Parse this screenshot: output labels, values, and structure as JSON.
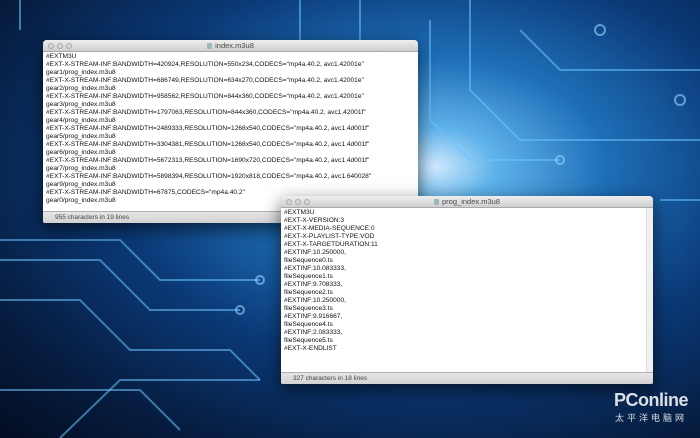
{
  "window1": {
    "title": "index.m3u8",
    "lines": [
      "#EXTM3U",
      "#EXT-X-STREAM-INF:BANDWIDTH=420924,RESOLUTION=550x234,CODECS=\"mp4a.40.2, avc1.42001e\"",
      "gear1/prog_index.m3u8",
      "#EXT-X-STREAM-INF:BANDWIDTH=686749,RESOLUTION=634x270,CODECS=\"mp4a.40.2, avc1.42001e\"",
      "gear2/prog_index.m3u8",
      "#EXT-X-STREAM-INF:BANDWIDTH=958562,RESOLUTION=844x360,CODECS=\"mp4a.40.2, avc1.42001e\"",
      "gear3/prog_index.m3u8",
      "#EXT-X-STREAM-INF:BANDWIDTH=1797063,RESOLUTION=844x360,CODECS=\"mp4a.40.2, avc1.42001f\"",
      "gear4/prog_index.m3u8",
      "#EXT-X-STREAM-INF:BANDWIDTH=2489333,RESOLUTION=1268x540,CODECS=\"mp4a.40.2, avc1.4d001f\"",
      "gear5/prog_index.m3u8",
      "#EXT-X-STREAM-INF:BANDWIDTH=3304381,RESOLUTION=1268x540,CODECS=\"mp4a.40.2, avc1.4d001f\"",
      "gear6/prog_index.m3u8",
      "#EXT-X-STREAM-INF:BANDWIDTH=5672313,RESOLUTION=1690x720,CODECS=\"mp4a.40.2, avc1.4d001f\"",
      "gear7/prog_index.m3u8",
      "#EXT-X-STREAM-INF:BANDWIDTH=5898394,RESOLUTION=1920x818,CODECS=\"mp4a.40.2, avc1.640028\"",
      "gear9/prog_index.m3u8",
      "#EXT-X-STREAM-INF:BANDWIDTH=67875,CODECS=\"mp4a.40.2\"",
      "gear0/prog_index.m3u8"
    ],
    "status": "955 characters in 19 lines"
  },
  "window2": {
    "title": "prog_index.m3u8",
    "lines": [
      "#EXTM3U",
      "#EXT-X-VERSION:3",
      "#EXT-X-MEDIA-SEQUENCE:0",
      "#EXT-X-PLAYLIST-TYPE:VOD",
      "#EXT-X-TARGETDURATION:11",
      "#EXTINF:10.250000,",
      "fileSequence0.ts",
      "#EXTINF:10.083333,",
      "fileSequence1.ts",
      "#EXTINF:9.708333,",
      "fileSequence2.ts",
      "#EXTINF:10.250000,",
      "fileSequence3.ts",
      "#EXTINF:9.916667,",
      "fileSequence4.ts",
      "#EXTINF:2.083333,",
      "fileSequence5.ts",
      "#EXT-X-ENDLIST"
    ],
    "status": "327 characters in 18 lines"
  },
  "watermark": {
    "brand": "PConline",
    "subtitle": "太平洋电脑网"
  }
}
